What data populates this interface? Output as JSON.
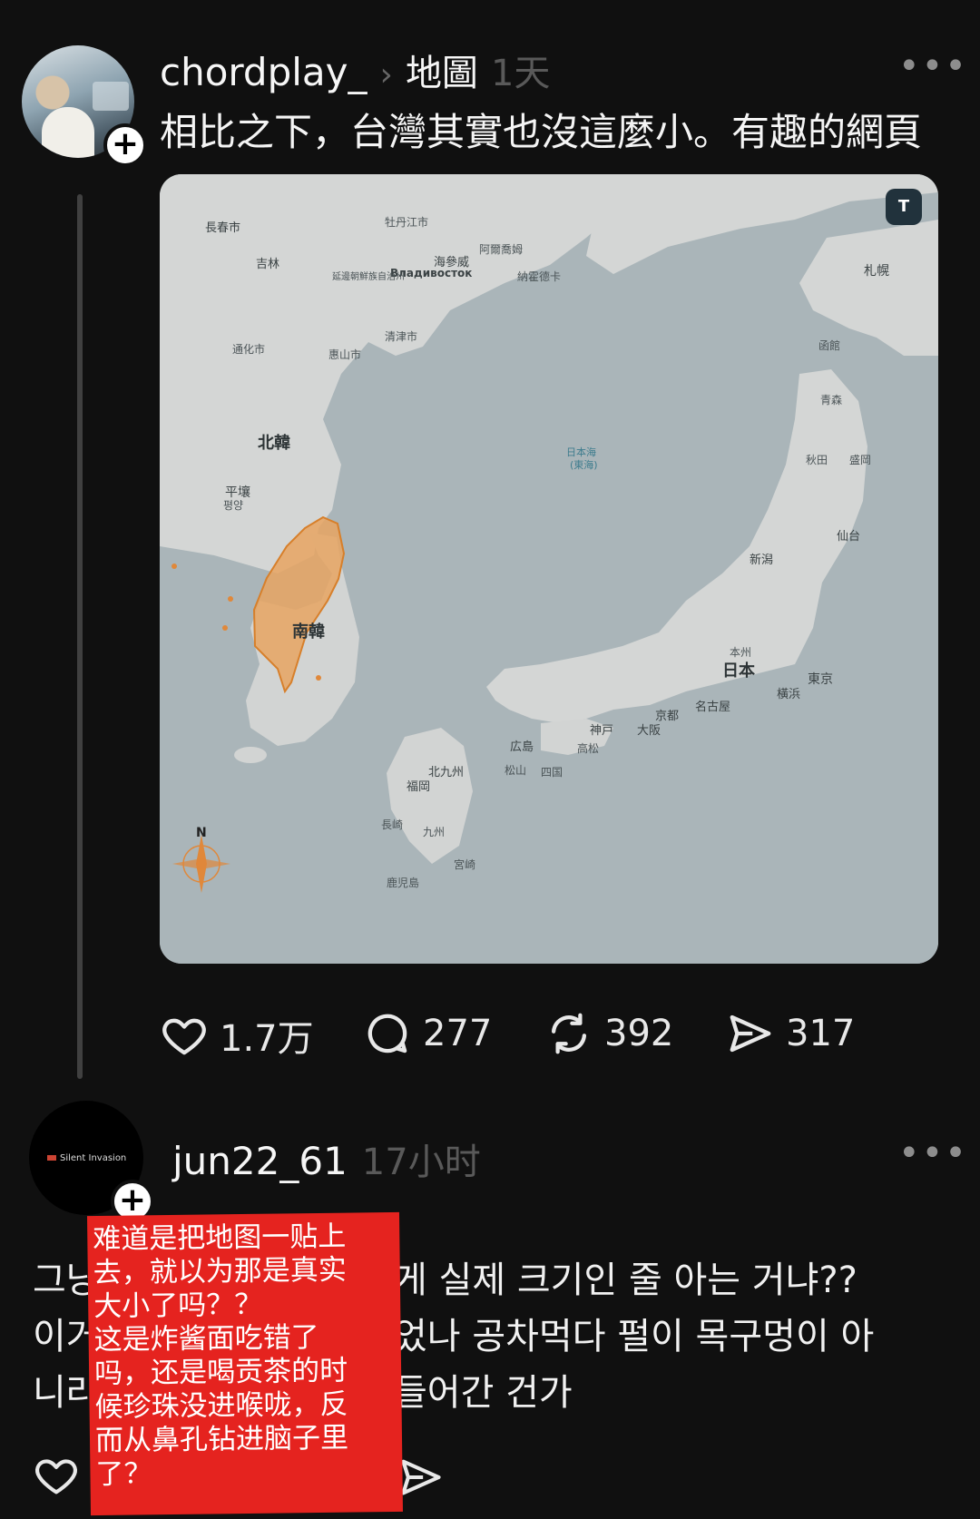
{
  "post": {
    "username": "chordplay_",
    "topic": "地圖",
    "time": "1天",
    "more": "•••",
    "text": "相比之下，台灣其實也沒這麼小。有趣的網頁",
    "map": {
      "toggle_label": "T",
      "labels": {
        "north_korea": "北韓",
        "south_korea": "南韓",
        "japan": "日本",
        "pyongyang": "平壤",
        "pyongyang_ko": "평양",
        "changchun": "長春市",
        "jilin": "吉林",
        "vladivostok": "Владивосток",
        "haishenwai": "海參威",
        "sea_of_japan": "日本海",
        "sea_of_japan_alt": "(東海)",
        "sapporo": "札幌",
        "hakodate": "函館",
        "aomori": "青森",
        "akita": "秋田",
        "morioka": "盛岡",
        "sendai": "仙台",
        "niigata": "新潟",
        "honshu": "本州",
        "tokyo": "東京",
        "yokohama": "橫浜",
        "nagoya": "名古屋",
        "kyoto": "京都",
        "osaka": "大阪",
        "kobe": "神戸",
        "hiroshima": "広島",
        "takamatsu": "高松",
        "shikoku": "四国",
        "matsuyama": "松山",
        "kitakyushu": "北九州",
        "fukuoka": "福岡",
        "nagasaki": "長崎",
        "kyushu": "九州",
        "miyazaki": "宮崎",
        "kagoshima": "鹿児島",
        "mudanjiang": "牡丹江市",
        "yanji": "延邊朝鮮族自治州",
        "hyesan": "惠山市",
        "chongjin": "清津市",
        "tonghua": "通化市",
        "nakhodka": "納霍德卡",
        "artem": "阿爾喬姆",
        "compass_n": "N"
      }
    },
    "actions": {
      "likes": "1.7万",
      "comments": "277",
      "reposts": "392",
      "shares": "317"
    }
  },
  "reply": {
    "avatar_text": "Silent Invasion",
    "username": "jun22_61",
    "time": "17小时",
    "more": "•••",
    "line1": "그냥",
    "line1_rest": "게 실제 크기인 줄 아는 거냐??",
    "line2": "이거",
    "line2_rest": "었나 공차먹다 펄이 목구멍이 아",
    "line3": "니라",
    "line3_rest": "들어간 건가"
  },
  "sticker": {
    "lines": [
      "难道是把地图一贴上",
      "去，就以为那是真实",
      "大小了吗？？",
      "这是炸酱面吃错了",
      "吗，还是喝贡茶的时",
      "候珍珠没进喉咙，反",
      "而从鼻孔钻进脑子里",
      "了？"
    ]
  }
}
